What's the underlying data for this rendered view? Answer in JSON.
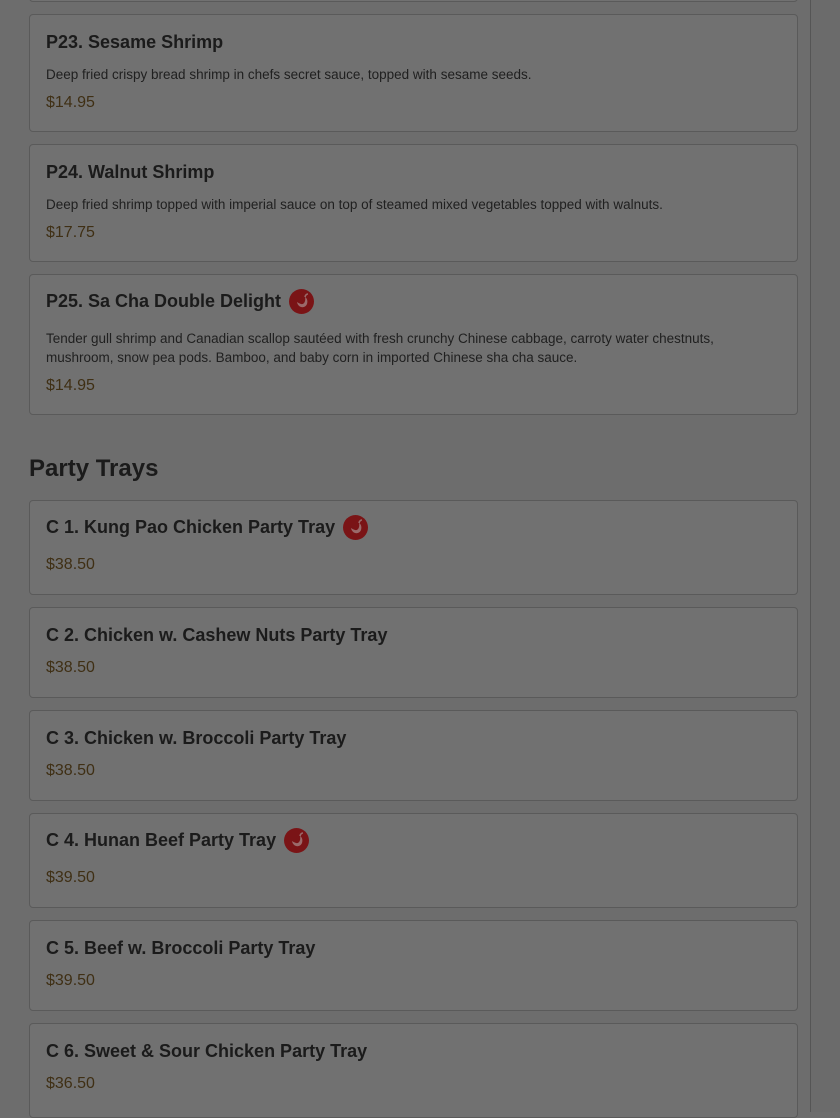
{
  "menu": {
    "items_top": [
      {
        "title": "P23. Sesame Shrimp",
        "description": "Deep fried crispy bread shrimp in chefs secret sauce, topped with sesame seeds.",
        "price": "$14.95",
        "spicy": false
      },
      {
        "title": "P24. Walnut Shrimp",
        "description": "Deep fried shrimp topped with imperial sauce on top of steamed mixed vegetables topped with walnuts.",
        "price": "$17.75",
        "spicy": false
      },
      {
        "title": "P25. Sa Cha Double Delight",
        "description": "Tender gull shrimp and Canadian scallop sautéed with fresh crunchy Chinese cabbage, carroty water chestnuts, mushroom, snow pea pods. Bamboo, and baby corn in imported Chinese sha cha sauce.",
        "price": "$14.95",
        "spicy": true
      }
    ],
    "section_title": "Party Trays",
    "party_trays": [
      {
        "title": "C 1. Kung Pao Chicken Party Tray",
        "price": "$38.50",
        "spicy": true
      },
      {
        "title": "C 2. Chicken w. Cashew Nuts Party Tray",
        "price": "$38.50",
        "spicy": false
      },
      {
        "title": "C 3. Chicken w. Broccoli Party Tray",
        "price": "$38.50",
        "spicy": false
      },
      {
        "title": "C 4. Hunan Beef Party Tray",
        "price": "$39.50",
        "spicy": true
      },
      {
        "title": "C 5. Beef w. Broccoli Party Tray",
        "price": "$39.50",
        "spicy": false
      },
      {
        "title": "C 6. Sweet & Sour Chicken Party Tray",
        "price": "$36.50",
        "spicy": false
      }
    ],
    "spicy_icon": "chili-pepper-icon",
    "spicy_color": "#7a1416",
    "price_color": "#3f2f14"
  }
}
